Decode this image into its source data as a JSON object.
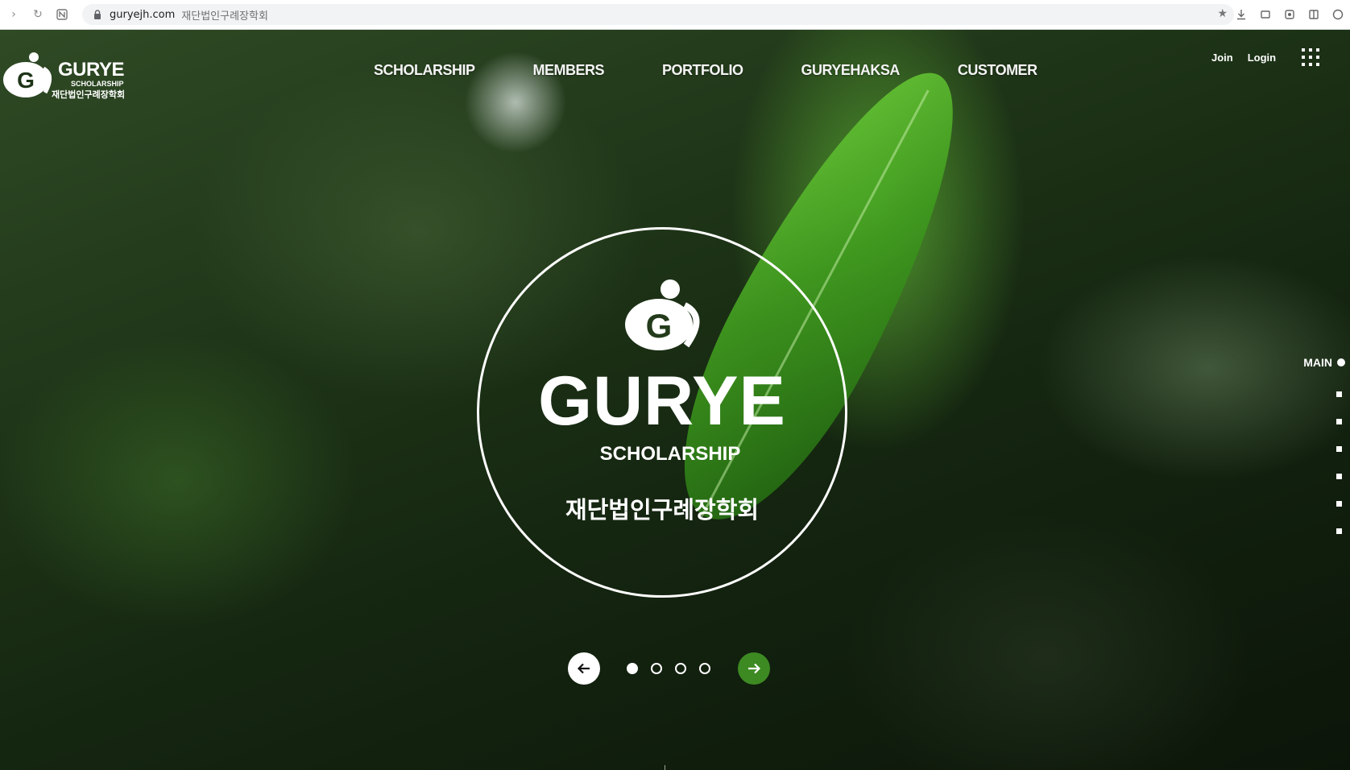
{
  "browser": {
    "url_domain": "guryejh.com",
    "tab_title": "재단법인구례장학회"
  },
  "logo": {
    "word": "GURYE",
    "sub": "SCHOLARSHIP",
    "korean": "재단법인구례장학회"
  },
  "nav": {
    "items": [
      {
        "label": "SCHOLARSHIP"
      },
      {
        "label": "MEMBERS"
      },
      {
        "label": "PORTFOLIO"
      },
      {
        "label": "GURYEHAKSA"
      },
      {
        "label": "CUSTOMER"
      }
    ],
    "join_label": "Join",
    "login_label": "Login"
  },
  "hero": {
    "brand": "GURYE",
    "sub": "SCHOLARSHIP",
    "korean": "재단법인구례장학회",
    "slide_count": 4,
    "active_slide": 1
  },
  "side_nav": {
    "main_label": "MAIN",
    "section_count": 7
  },
  "colors": {
    "accent_green": "#3d8a23",
    "white": "#ffffff"
  },
  "icons": {
    "prev": "arrow-left-icon",
    "next": "arrow-right-icon",
    "menu": "grid-menu-icon"
  }
}
